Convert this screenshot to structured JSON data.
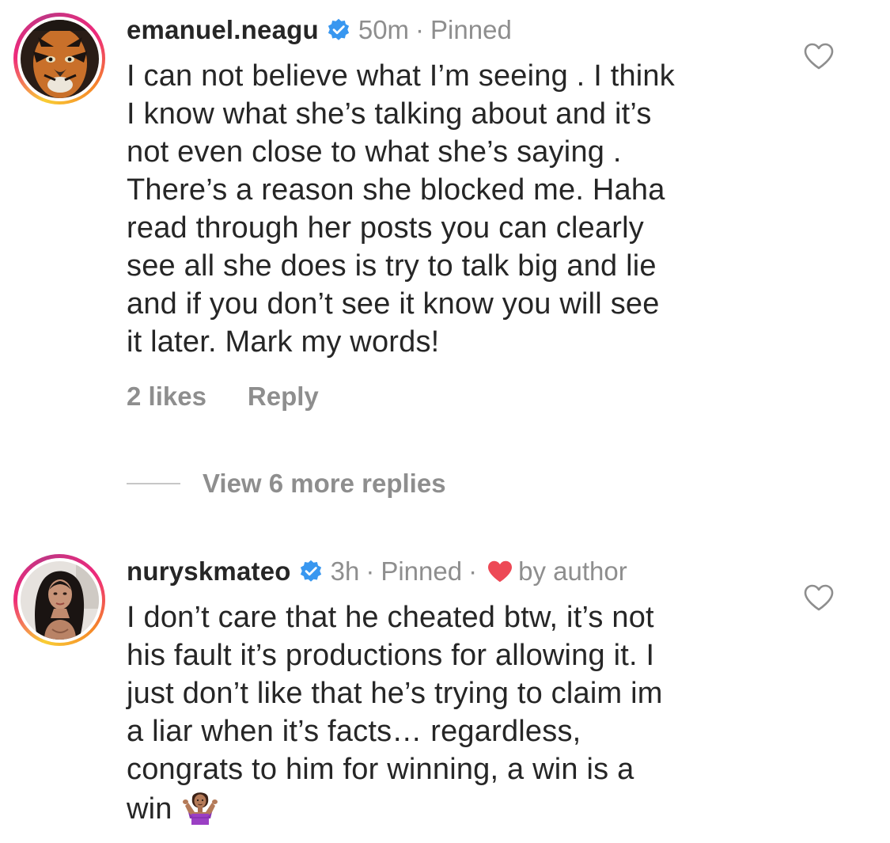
{
  "comments": [
    {
      "username": "emanuel.neagu",
      "time": "50m",
      "pinned": "Pinned",
      "text_lines": [
        "I can not believe what I’m seeing . I think",
        "I know what she’s talking about and it’s",
        "not even close to what she’s saying .",
        "There’s a reason she blocked me. Haha",
        "read through her posts you can clearly",
        "see all she does is try to talk big and lie",
        "and if you don’t see it know you will see",
        "it later. Mark my words!"
      ],
      "likes": "2 likes",
      "reply_label": "Reply",
      "view_replies": "View 6 more replies",
      "avatar_icon": "tiger-face-avatar"
    },
    {
      "username": "nuryskmateo",
      "time": "3h",
      "pinned": "Pinned",
      "liked_by": "by author",
      "text_lines": [
        "I don’t care that he cheated btw, it’s not",
        "his fault it’s productions for allowing it. I",
        "just don’t like that he’s trying to claim im",
        "a liar when it’s facts… regardless,",
        "congrats to him for winning, a win is a",
        "win"
      ],
      "emoji": "🤷🏽‍♀️",
      "avatar_icon": "woman-portrait-avatar"
    }
  ],
  "separator": "·",
  "colors": {
    "text": "#262626",
    "secondary": "#8e8e8e",
    "verified_blue": "#3897f0",
    "author_heart": "#ed4956"
  }
}
